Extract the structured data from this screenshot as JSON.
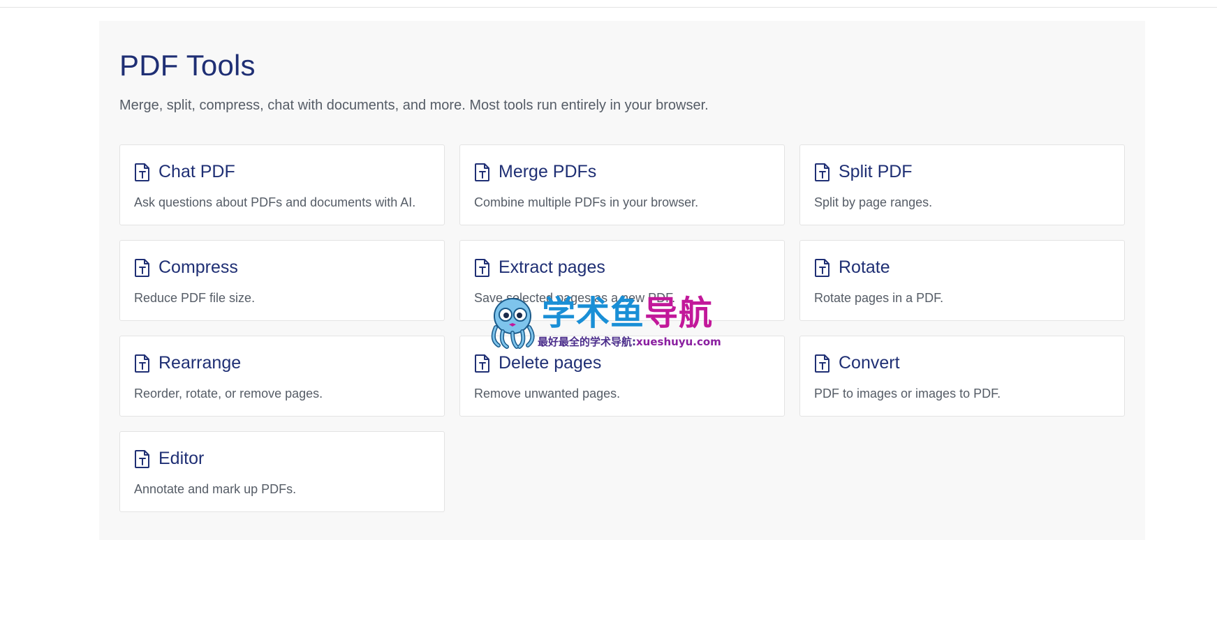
{
  "page": {
    "title": "PDF Tools",
    "subtitle": "Merge, split, compress, chat with documents, and more. Most tools run entirely in your browser."
  },
  "tools": [
    {
      "name": "chat-pdf",
      "title": "Chat PDF",
      "description": "Ask questions about PDFs and documents with AI.",
      "icon": "pdf-file-icon"
    },
    {
      "name": "merge-pdfs",
      "title": "Merge PDFs",
      "description": "Combine multiple PDFs in your browser.",
      "icon": "pdf-file-icon"
    },
    {
      "name": "split-pdf",
      "title": "Split PDF",
      "description": "Split by page ranges.",
      "icon": "pdf-file-icon"
    },
    {
      "name": "compress",
      "title": "Compress",
      "description": "Reduce PDF file size.",
      "icon": "pdf-file-icon"
    },
    {
      "name": "extract-pages",
      "title": "Extract pages",
      "description": "Save selected pages as a new PDF.",
      "icon": "pdf-file-icon"
    },
    {
      "name": "rotate",
      "title": "Rotate",
      "description": "Rotate pages in a PDF.",
      "icon": "pdf-file-icon"
    },
    {
      "name": "rearrange",
      "title": "Rearrange",
      "description": "Reorder, rotate, or remove pages.",
      "icon": "pdf-file-icon"
    },
    {
      "name": "delete-pages",
      "title": "Delete pages",
      "description": "Remove unwanted pages.",
      "icon": "pdf-file-icon"
    },
    {
      "name": "convert",
      "title": "Convert",
      "description": "PDF to images or images to PDF.",
      "icon": "pdf-file-icon"
    },
    {
      "name": "editor",
      "title": "Editor",
      "description": "Annotate and mark up PDFs.",
      "icon": "pdf-file-icon"
    }
  ],
  "watermark": {
    "brand_part1": "学术鱼",
    "brand_part2": "导航",
    "tagline": "最好最全的学术导航:",
    "url": "xueshuyu.com",
    "icon": "octopus-mascot-icon"
  },
  "colors": {
    "title": "#1f2f74",
    "text": "#555c66",
    "panel_bg": "#f8f8f8",
    "card_border": "#e3e3e3",
    "watermark_blue": "#1a8fd6",
    "watermark_magenta": "#c2189a"
  }
}
